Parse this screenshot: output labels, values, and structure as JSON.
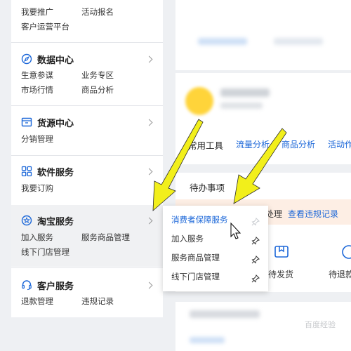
{
  "sidebar": {
    "top_links": [
      "我要推广",
      "活动报名",
      "客户运营平台"
    ],
    "sections": [
      {
        "title": "数据中心",
        "icon": "compass-icon",
        "links": [
          "生意参谋",
          "业务专区",
          "市场行情",
          "商品分析"
        ]
      },
      {
        "title": "货源中心",
        "icon": "box-icon",
        "links": [
          "分销管理"
        ]
      },
      {
        "title": "软件服务",
        "icon": "grid-apps-icon",
        "links": [
          "我要订购"
        ]
      },
      {
        "title": "淘宝服务",
        "icon": "star-badge-icon",
        "links": [
          "加入服务",
          "服务商品管理",
          "线下门店管理"
        ]
      },
      {
        "title": "客户服务",
        "icon": "headset-icon",
        "links": [
          "退款管理",
          "违规记录"
        ]
      }
    ]
  },
  "popup": {
    "items": [
      "消费者保障服务",
      "加入服务",
      "服务商品管理",
      "线下门店管理"
    ],
    "highlighted_index": 0
  },
  "main": {
    "tools_title": "常用工具",
    "tool_links": [
      "流量分析",
      "商品分析",
      "活动作"
    ],
    "todo_title": "待办事项",
    "notice_text": "处理",
    "notice_link": "查看违规记录",
    "stats": [
      "待发货",
      "待退款"
    ]
  },
  "watermark": "百度经验",
  "colors": {
    "link": "#1a66d8",
    "arrow": "#f2ef1b",
    "notice_bg": "#fdeee4",
    "avatar": "#ffd43a"
  }
}
